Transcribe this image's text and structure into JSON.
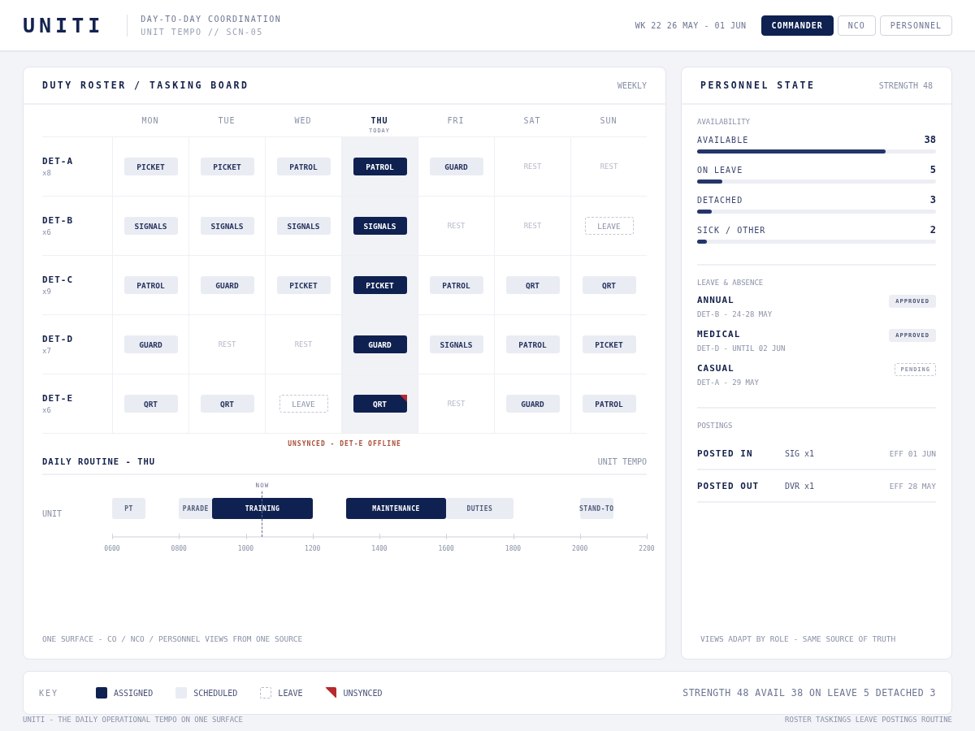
{
  "header": {
    "logo": "UNITI",
    "subtitle": "DAY-TO-DAY COORDINATION",
    "context": "UNIT TEMPO // SCN-05",
    "week": "WK 22 26 MAY - 01 JUN",
    "roles": [
      {
        "label": "COMMANDER",
        "selected": true
      },
      {
        "label": "NCO",
        "selected": false
      },
      {
        "label": "PERSONNEL",
        "selected": false
      }
    ]
  },
  "roster": {
    "title": "DUTY ROSTER / TASKING BOARD",
    "period": "WEEKLY",
    "days": [
      {
        "label": "MON",
        "today": false
      },
      {
        "label": "TUE",
        "today": false
      },
      {
        "label": "WED",
        "today": false
      },
      {
        "label": "THU",
        "today": true,
        "note": "TODAY"
      },
      {
        "label": "FRI",
        "today": false
      },
      {
        "label": "SAT",
        "today": false
      },
      {
        "label": "SUN",
        "today": false
      }
    ],
    "rows": [
      {
        "name": "DET-A",
        "count": "x8",
        "cells": [
          {
            "label": "PICKET",
            "kind": "scheduled"
          },
          {
            "label": "PICKET",
            "kind": "scheduled"
          },
          {
            "label": "PATROL",
            "kind": "scheduled"
          },
          {
            "label": "PATROL",
            "kind": "assigned"
          },
          {
            "label": "GUARD",
            "kind": "scheduled"
          },
          {
            "label": "REST",
            "kind": "rest"
          },
          {
            "label": "REST",
            "kind": "rest"
          }
        ]
      },
      {
        "name": "DET-B",
        "count": "x6",
        "cells": [
          {
            "label": "SIGNALS",
            "kind": "scheduled"
          },
          {
            "label": "SIGNALS",
            "kind": "scheduled"
          },
          {
            "label": "SIGNALS",
            "kind": "scheduled"
          },
          {
            "label": "SIGNALS",
            "kind": "assigned"
          },
          {
            "label": "REST",
            "kind": "rest"
          },
          {
            "label": "REST",
            "kind": "rest"
          },
          {
            "label": "LEAVE",
            "kind": "leave"
          }
        ]
      },
      {
        "name": "DET-C",
        "count": "x9",
        "cells": [
          {
            "label": "PATROL",
            "kind": "scheduled"
          },
          {
            "label": "GUARD",
            "kind": "scheduled"
          },
          {
            "label": "PICKET",
            "kind": "scheduled"
          },
          {
            "label": "PICKET",
            "kind": "assigned"
          },
          {
            "label": "PATROL",
            "kind": "scheduled"
          },
          {
            "label": "QRT",
            "kind": "scheduled"
          },
          {
            "label": "QRT",
            "kind": "scheduled"
          }
        ]
      },
      {
        "name": "DET-D",
        "count": "x7",
        "cells": [
          {
            "label": "GUARD",
            "kind": "scheduled"
          },
          {
            "label": "REST",
            "kind": "rest"
          },
          {
            "label": "REST",
            "kind": "rest"
          },
          {
            "label": "GUARD",
            "kind": "assigned"
          },
          {
            "label": "SIGNALS",
            "kind": "scheduled"
          },
          {
            "label": "PATROL",
            "kind": "scheduled"
          },
          {
            "label": "PICKET",
            "kind": "scheduled"
          }
        ]
      },
      {
        "name": "DET-E",
        "count": "x6",
        "cells": [
          {
            "label": "QRT",
            "kind": "scheduled"
          },
          {
            "label": "QRT",
            "kind": "scheduled"
          },
          {
            "label": "LEAVE",
            "kind": "leave"
          },
          {
            "label": "QRT",
            "kind": "assigned",
            "unsynced": true
          },
          {
            "label": "REST",
            "kind": "rest"
          },
          {
            "label": "GUARD",
            "kind": "scheduled"
          },
          {
            "label": "PATROL",
            "kind": "scheduled"
          }
        ]
      }
    ],
    "alert": "UNSYNCED - DET-E OFFLINE"
  },
  "routine": {
    "title": "DAILY ROUTINE - THU",
    "tag": "UNIT TEMPO",
    "lane": "UNIT",
    "slots": [
      {
        "kind": "scheduled",
        "label": "PT"
      },
      {
        "kind": "free"
      },
      {
        "kind": "scheduled",
        "label": "PARADE"
      },
      {
        "kind": "assigned",
        "label": "TRAINING"
      },
      {
        "kind": "assigned"
      },
      {
        "kind": "assigned"
      },
      {
        "kind": "free"
      },
      {
        "kind": "assigned",
        "label": "MAINTENANCE"
      },
      {
        "kind": "assigned"
      },
      {
        "kind": "assigned"
      },
      {
        "kind": "scheduled",
        "label": "DUTIES"
      },
      {
        "kind": "scheduled"
      },
      {
        "kind": "free"
      },
      {
        "kind": "free"
      },
      {
        "kind": "scheduled",
        "label": "STAND-TO"
      },
      {
        "kind": "free"
      }
    ],
    "ticks": [
      "0600",
      "0800",
      "1000",
      "1200",
      "1400",
      "1600",
      "1800",
      "2000",
      "2200"
    ],
    "now": {
      "label": "NOW",
      "level": 0.281
    }
  },
  "roster_footnote": "ONE SURFACE - CO / NCO / PERSONNEL VIEWS FROM ONE SOURCE",
  "personnel": {
    "title": "PERSONNEL STATE",
    "strength": "STRENGTH 48",
    "availability_title": "AVAILABILITY",
    "availability": [
      {
        "label": "AVAILABLE",
        "value": "38",
        "level": 0.79
      },
      {
        "label": "ON LEAVE",
        "value": "5",
        "level": 0.104
      },
      {
        "label": "DETACHED",
        "value": "3",
        "level": 0.0625
      },
      {
        "label": "SICK / OTHER",
        "value": "2",
        "level": 0.042
      }
    ],
    "leave_title": "LEAVE & ABSENCE",
    "leave": [
      {
        "type": "ANNUAL",
        "detail": "DET-B - 24-28 MAY",
        "status": "APPROVED",
        "kind": "approved"
      },
      {
        "type": "MEDICAL",
        "detail": "DET-D - UNTIL 02 JUN",
        "status": "APPROVED",
        "kind": "approved"
      },
      {
        "type": "CASUAL",
        "detail": "DET-A - 29 MAY",
        "status": "PENDING",
        "kind": "pending"
      }
    ],
    "postings_title": "POSTINGS",
    "postings": [
      {
        "label": "POSTED IN",
        "unit": "SIG x1",
        "effective": "EFF 01 JUN"
      },
      {
        "label": "POSTED OUT",
        "unit": "DVR x1",
        "effective": "EFF 28 MAY"
      }
    ],
    "footnote": "VIEWS ADAPT BY ROLE - SAME SOURCE OF TRUTH"
  },
  "key": {
    "title": "KEY",
    "items": [
      {
        "label": "ASSIGNED",
        "kind": "assigned"
      },
      {
        "label": "SCHEDULED",
        "kind": "scheduled"
      },
      {
        "label": "LEAVE",
        "kind": "leave"
      },
      {
        "label": "UNSYNCED",
        "kind": "unsynced"
      }
    ],
    "summary": "STRENGTH 48 AVAIL 38 ON LEAVE 5 DETACHED 3"
  },
  "footer": {
    "left": "UNITI - THE DAILY OPERATIONAL TEMPO ON ONE SURFACE",
    "right": "ROSTER TASKINGS LEAVE POSTINGS ROUTINE"
  }
}
